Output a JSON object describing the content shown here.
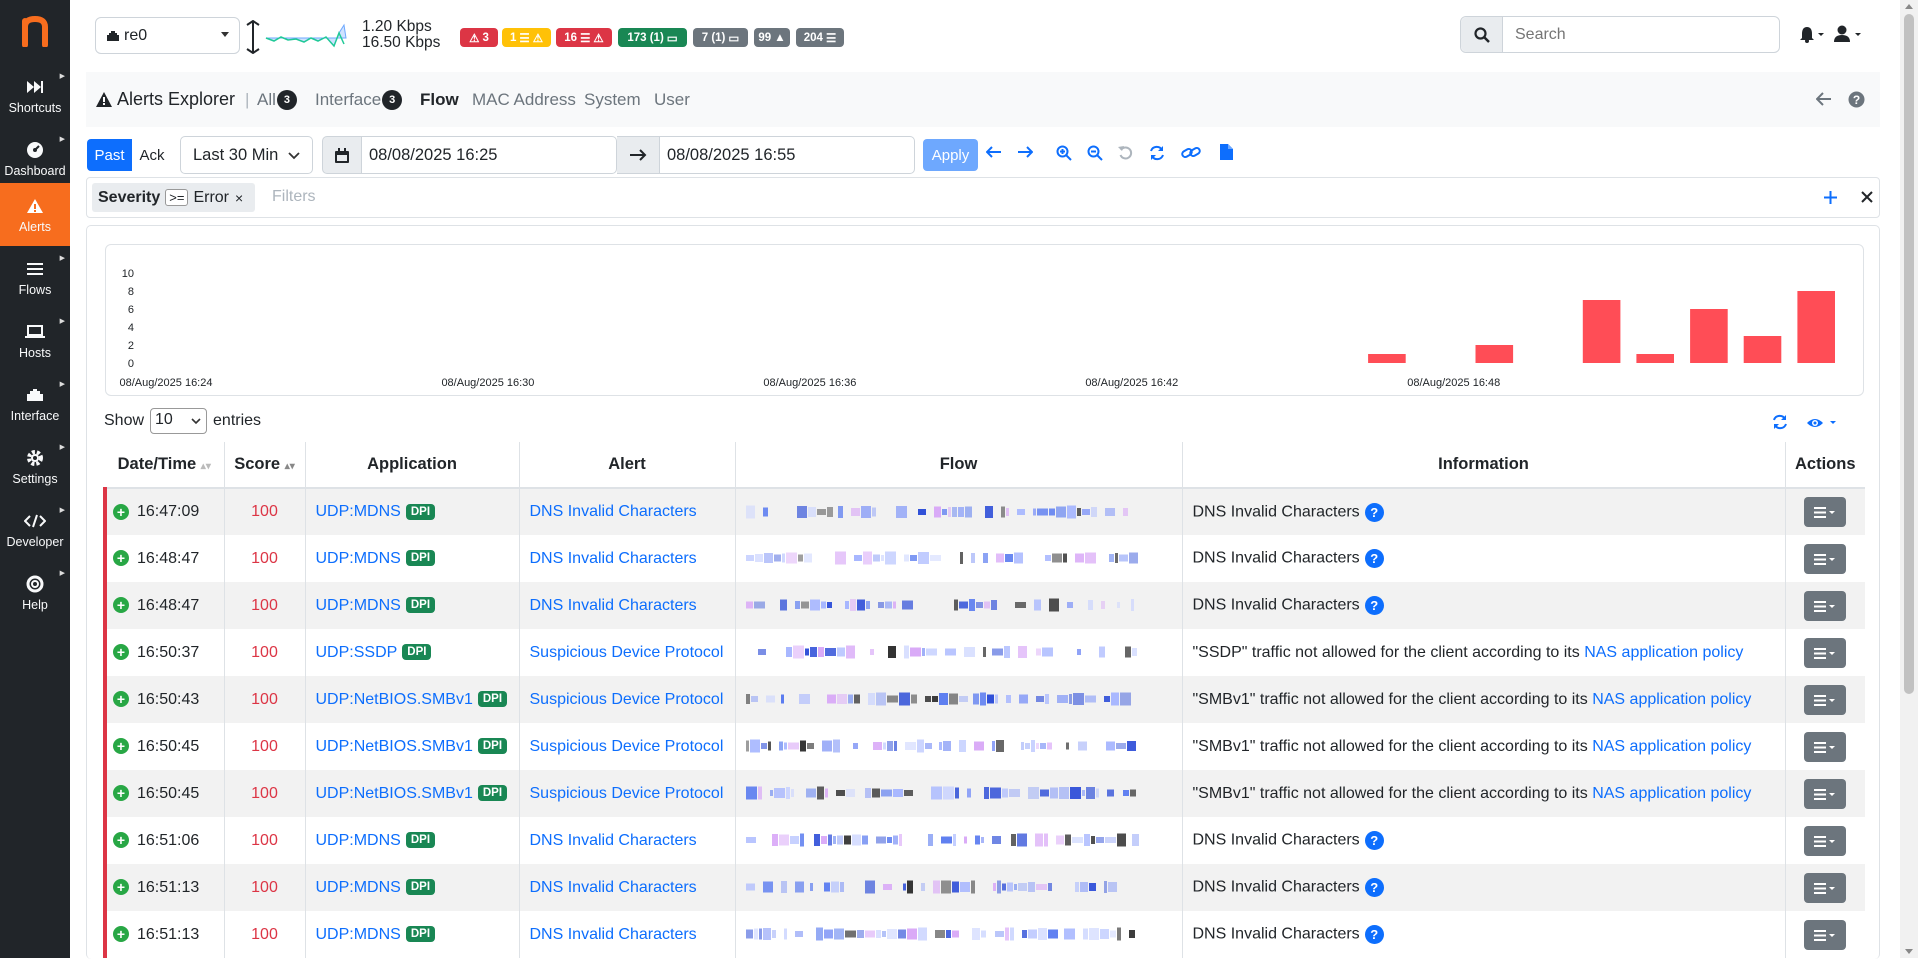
{
  "sidebar": {
    "items": [
      {
        "label": "Shortcuts",
        "icon": "forward-icon"
      },
      {
        "label": "Dashboard",
        "icon": "gauge-icon"
      },
      {
        "label": "Alerts",
        "icon": "warning-icon"
      },
      {
        "label": "Flows",
        "icon": "bars-icon"
      },
      {
        "label": "Hosts",
        "icon": "laptop-icon"
      },
      {
        "label": "Interface",
        "icon": "ethernet-icon"
      },
      {
        "label": "Settings",
        "icon": "gear-icon"
      },
      {
        "label": "Developer",
        "icon": "code-icon"
      },
      {
        "label": "Help",
        "icon": "lifebuoy-icon"
      }
    ],
    "active": "Alerts",
    "accent": "#f76d1e"
  },
  "topbar": {
    "interface": "re0",
    "upload": "1.20 Kbps",
    "download": "16.50 Kbps",
    "badges": [
      "3",
      "1",
      "16",
      "173 (1)",
      "7 (1)",
      "99",
      "204"
    ],
    "search_placeholder": "Search"
  },
  "subnav": {
    "title": "Alerts Explorer",
    "tabs": [
      {
        "label": "All",
        "count": "3"
      },
      {
        "label": "Interface",
        "count": "3"
      },
      {
        "label": "Flow"
      },
      {
        "label": "MAC Address"
      },
      {
        "label": "System"
      },
      {
        "label": "User"
      }
    ],
    "active_tab": "Flow"
  },
  "timebar": {
    "past": "Past",
    "ack": "Ack",
    "range": "Last 30 Min",
    "from": "08/08/2025 16:25",
    "to": "08/08/2025 16:55",
    "apply": "Apply"
  },
  "filter": {
    "key": "Severity",
    "op": ">=",
    "value": "Error",
    "placeholder": "Filters"
  },
  "chart_data": {
    "type": "bar",
    "y_ticks": [
      "10",
      "8",
      "6",
      "4",
      "2",
      "0"
    ],
    "ylim": [
      0,
      10
    ],
    "x_ticks": [
      "08/Aug/2025 16:24",
      "08/Aug/2025 16:30",
      "08/Aug/2025 16:36",
      "08/Aug/2025 16:42",
      "08/Aug/2025 16:48"
    ],
    "x_range_minutes": [
      0,
      31
    ],
    "bars": [
      {
        "minute": 23,
        "value": 1
      },
      {
        "minute": 25,
        "value": 2
      },
      {
        "minute": 27,
        "value": 7
      },
      {
        "minute": 28,
        "value": 1
      },
      {
        "minute": 29,
        "value": 6
      },
      {
        "minute": 30,
        "value": 3
      },
      {
        "minute": 31,
        "value": 8
      }
    ],
    "color": "#ff4d56"
  },
  "table": {
    "show_label": "Show",
    "page_size": "10",
    "entries_label": "entries",
    "columns": [
      "Date/Time",
      "Score",
      "Application",
      "Alert",
      "Flow",
      "Information",
      "Actions"
    ],
    "rows": [
      {
        "time": "16:47:09",
        "score": "100",
        "app": "UDP:MDNS",
        "dpi": "DPI",
        "alert": "DNS Invalid Characters",
        "info": "DNS Invalid Characters",
        "link": ""
      },
      {
        "time": "16:48:47",
        "score": "100",
        "app": "UDP:MDNS",
        "dpi": "DPI",
        "alert": "DNS Invalid Characters",
        "info": "DNS Invalid Characters",
        "link": ""
      },
      {
        "time": "16:48:47",
        "score": "100",
        "app": "UDP:MDNS",
        "dpi": "DPI",
        "alert": "DNS Invalid Characters",
        "info": "DNS Invalid Characters",
        "link": ""
      },
      {
        "time": "16:50:37",
        "score": "100",
        "app": "UDP:SSDP",
        "dpi": "DPI",
        "alert": "Suspicious Device Protocol",
        "info": "\"SSDP\" traffic not allowed for the client according to its ",
        "link": "NAS application policy"
      },
      {
        "time": "16:50:43",
        "score": "100",
        "app": "UDP:NetBIOS.SMBv1",
        "dpi": "DPI",
        "alert": "Suspicious Device Protocol",
        "info": "\"SMBv1\" traffic not allowed for the client according to its ",
        "link": "NAS application policy"
      },
      {
        "time": "16:50:45",
        "score": "100",
        "app": "UDP:NetBIOS.SMBv1",
        "dpi": "DPI",
        "alert": "Suspicious Device Protocol",
        "info": "\"SMBv1\" traffic not allowed for the client according to its ",
        "link": "NAS application policy"
      },
      {
        "time": "16:50:45",
        "score": "100",
        "app": "UDP:NetBIOS.SMBv1",
        "dpi": "DPI",
        "alert": "Suspicious Device Protocol",
        "info": "\"SMBv1\" traffic not allowed for the client according to its ",
        "link": "NAS application policy"
      },
      {
        "time": "16:51:06",
        "score": "100",
        "app": "UDP:MDNS",
        "dpi": "DPI",
        "alert": "DNS Invalid Characters",
        "info": "DNS Invalid Characters",
        "link": ""
      },
      {
        "time": "16:51:13",
        "score": "100",
        "app": "UDP:MDNS",
        "dpi": "DPI",
        "alert": "DNS Invalid Characters",
        "info": "DNS Invalid Characters",
        "link": ""
      },
      {
        "time": "16:51:13",
        "score": "100",
        "app": "UDP:MDNS",
        "dpi": "DPI",
        "alert": "DNS Invalid Characters",
        "info": "DNS Invalid Characters",
        "link": ""
      }
    ]
  }
}
